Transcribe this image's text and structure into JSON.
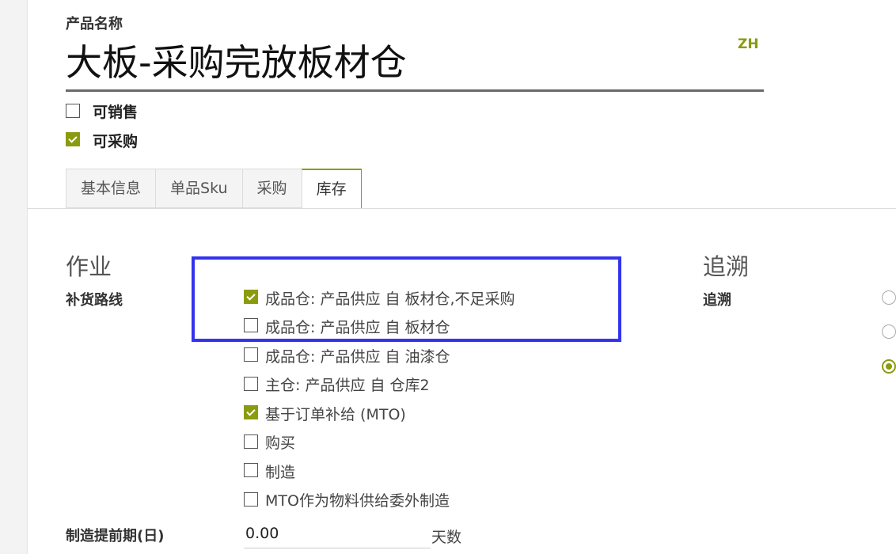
{
  "header": {
    "field_label": "产品名称",
    "product_name": "大板-采购完放板材仓",
    "language": "ZH"
  },
  "flags": {
    "sale_ok": {
      "label": "可销售",
      "checked": false
    },
    "purchase_ok": {
      "label": "可采购",
      "checked": true
    }
  },
  "tabs": [
    {
      "label": "基本信息",
      "active": false
    },
    {
      "label": "单品Sku",
      "active": false
    },
    {
      "label": "采购",
      "active": false
    },
    {
      "label": "库存",
      "active": true
    }
  ],
  "operations": {
    "title": "作业",
    "routes_label": "补货路线",
    "routes": [
      {
        "label": "成品仓: 产品供应 自 板材仓,不足采购",
        "checked": true
      },
      {
        "label": "成品仓: 产品供应 自 板材仓",
        "checked": false
      },
      {
        "label": "成品仓: 产品供应 自 油漆仓",
        "checked": false
      },
      {
        "label": "主仓: 产品供应 自 仓库2",
        "checked": false
      },
      {
        "label": "基于订单补给 (MTO)",
        "checked": true
      },
      {
        "label": "购买",
        "checked": false
      },
      {
        "label": "制造",
        "checked": false
      },
      {
        "label": "MTO作为物料供给委外制造",
        "checked": false
      }
    ],
    "lead_time_label": "制造提前期(日)",
    "lead_time_value": "0.00",
    "lead_time_unit": "天数"
  },
  "traceability": {
    "title": "追溯",
    "field_label": "追溯",
    "options_selected": [
      false,
      false,
      true
    ]
  },
  "colors": {
    "accent": "#8a9b10",
    "highlight": "#3333ee"
  }
}
